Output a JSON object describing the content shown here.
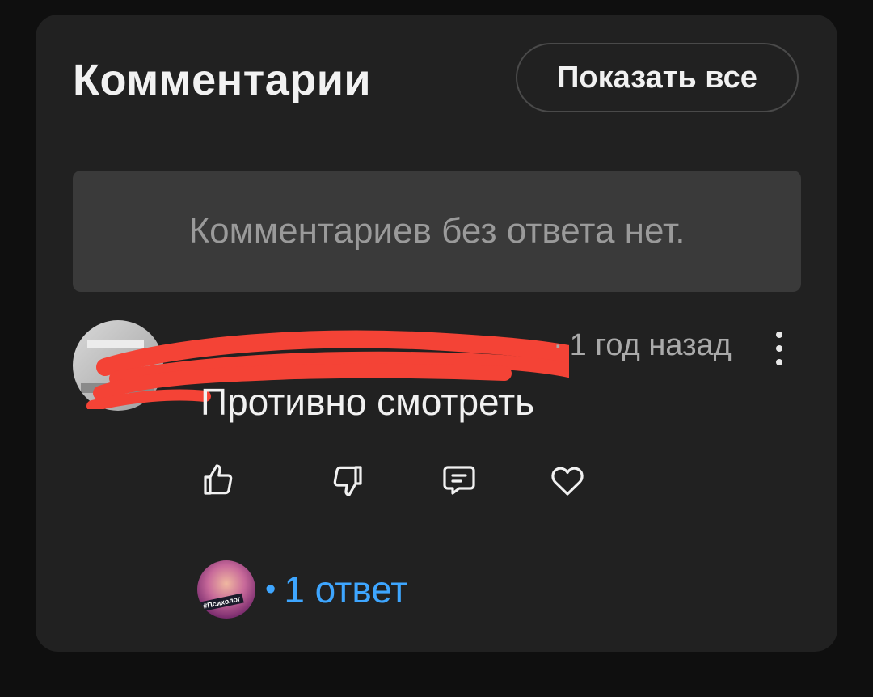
{
  "header": {
    "title": "Комментарии",
    "show_all_label": "Показать все"
  },
  "empty_state": {
    "text": "Комментариев без ответа нет."
  },
  "comment": {
    "time": "1 год назад",
    "text": "Противно смотреть",
    "actions": [
      "like-icon",
      "dislike-icon",
      "reply-icon",
      "heart-icon"
    ],
    "replies": {
      "count_label": "1 ответ",
      "avatar_tag": "#Психолог"
    }
  },
  "colors": {
    "background": "#0f0f0f",
    "card": "#212121",
    "empty_box": "#3a3a3a",
    "link": "#3ea6ff",
    "redaction": "#f44336"
  }
}
